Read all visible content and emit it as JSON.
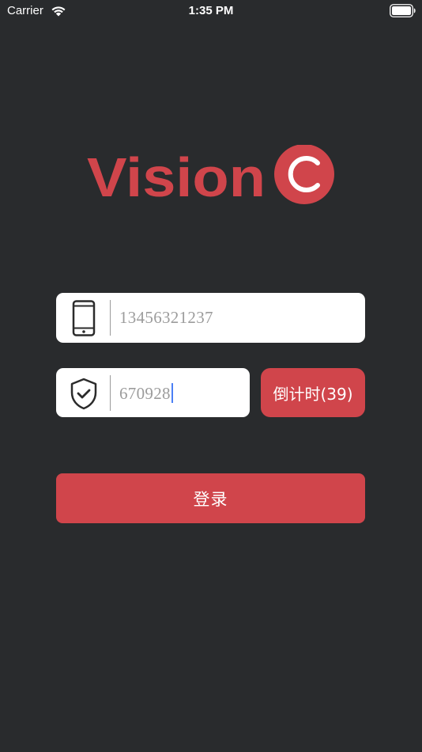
{
  "status_bar": {
    "carrier": "Carrier",
    "time": "1:35 PM",
    "wifi_icon": "wifi-icon",
    "battery_icon": "battery-full-icon"
  },
  "logo": {
    "text": "Vision",
    "badge_letter": "C",
    "color": "#d0454b"
  },
  "phone_field": {
    "icon": "smartphone-icon",
    "value": "13456321237"
  },
  "code_field": {
    "icon": "shield-check-icon",
    "value": "670928"
  },
  "countdown_button": {
    "label": "倒计时(39)"
  },
  "login_button": {
    "label": "登录"
  },
  "colors": {
    "background": "#292b2d",
    "accent": "#d0454b",
    "input_text": "#9c9c9c",
    "caret": "#4b7ff5"
  }
}
